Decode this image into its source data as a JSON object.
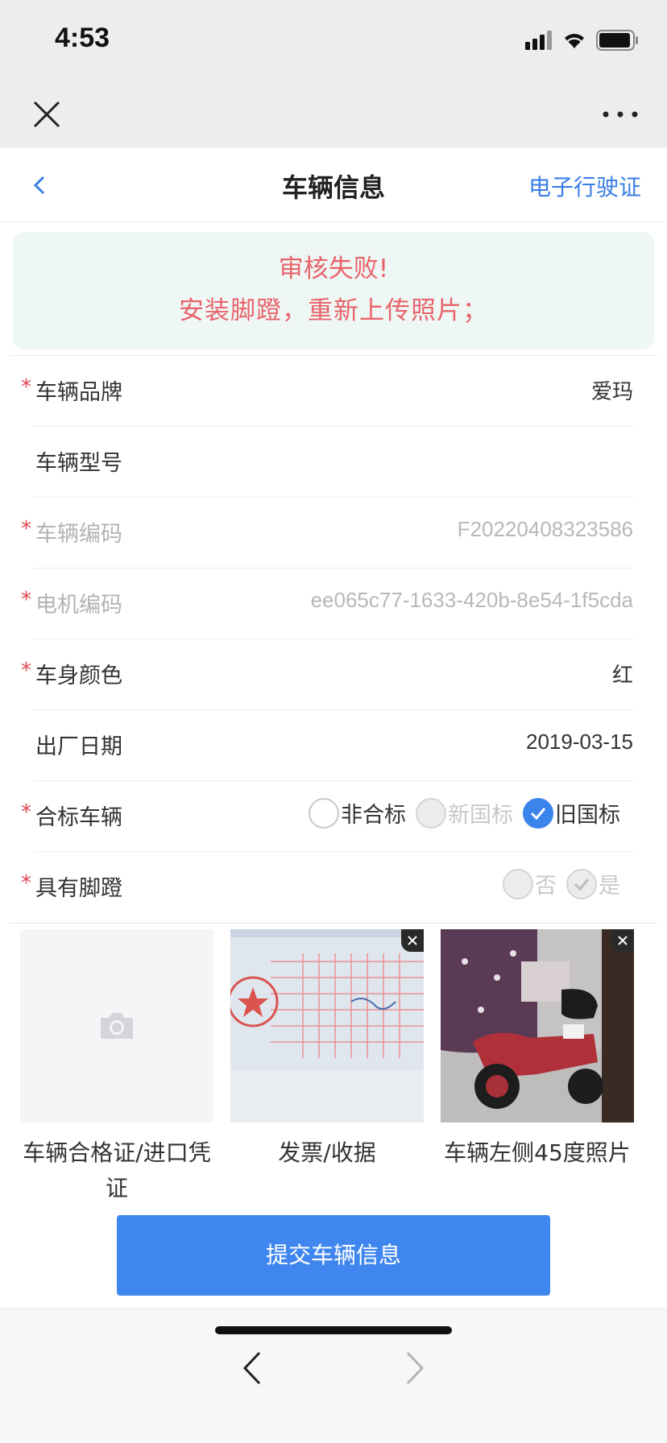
{
  "status": {
    "time": "4:53"
  },
  "nav": {
    "title": "车辆信息",
    "right_link": "电子行驶证"
  },
  "alert": {
    "line1": "审核失败!",
    "line2": "安装脚蹬，重新上传照片；"
  },
  "form": {
    "brand": {
      "label": "车辆品牌",
      "value": "爱玛"
    },
    "model": {
      "label": "车辆型号",
      "value": ""
    },
    "vehicle_code": {
      "label": "车辆编码",
      "value": "F20220408323586"
    },
    "motor_code": {
      "label": "电机编码",
      "value": "ee065c77-1633-420b-8e54-1f5cda"
    },
    "color": {
      "label": "车身颜色",
      "value": "红"
    },
    "manufacture_date": {
      "label": "出厂日期",
      "value": "2019-03-15"
    },
    "compliance": {
      "label": "合标车辆",
      "options": [
        "非合标",
        "新国标",
        "旧国标"
      ],
      "selected": "旧国标"
    },
    "pedals": {
      "label": "具有脚蹬",
      "options": [
        "否",
        "是"
      ],
      "selected": ""
    }
  },
  "photos": [
    {
      "label": "车辆合格证/进口凭证",
      "icon": "camera-icon"
    },
    {
      "label": "发票/收据"
    },
    {
      "label": "车辆左侧45度照片"
    }
  ],
  "submit_label": "提交车辆信息",
  "colors": {
    "accent": "#3f87ef",
    "error": "#e9636c",
    "alert_bg": "#eef7f4"
  }
}
